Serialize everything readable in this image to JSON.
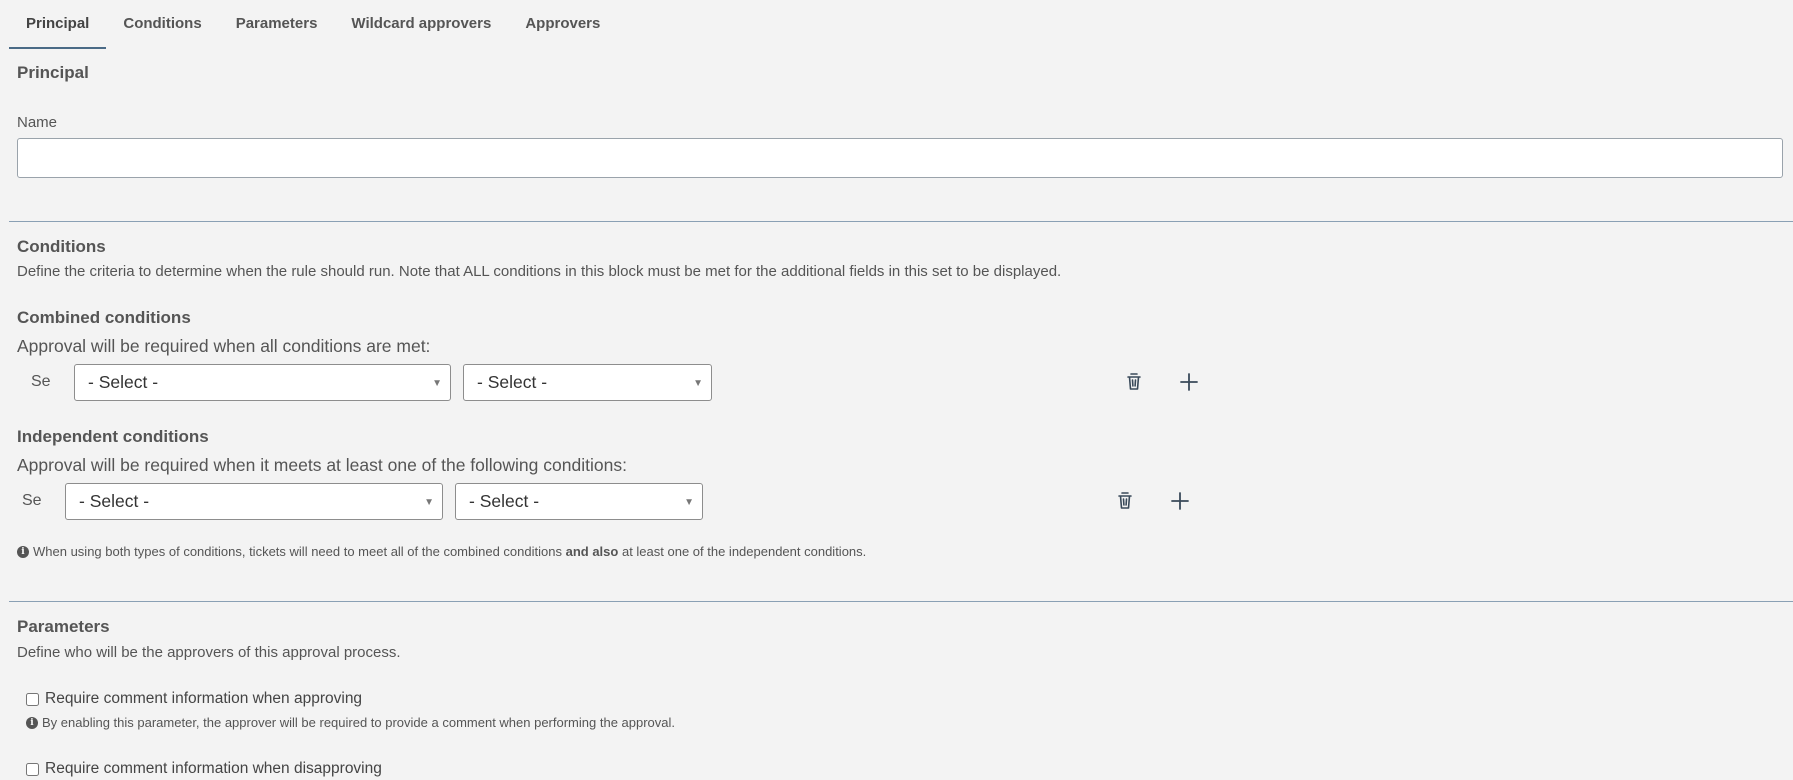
{
  "tabs": [
    "Principal",
    "Conditions",
    "Parameters",
    "Wildcard approvers",
    "Approvers"
  ],
  "principal": {
    "title": "Principal",
    "name_label": "Name",
    "name_value": ""
  },
  "conditions": {
    "title": "Conditions",
    "description": "Define the criteria to determine when the rule should run. Note that ALL conditions in this block must be met for the additional fields in this set to be displayed.",
    "combined": {
      "title": "Combined conditions",
      "description": "Approval will be required when all conditions are met:",
      "row_prefix": "Se",
      "select1": "- Select -",
      "select2": "- Select -"
    },
    "independent": {
      "title": "Independent conditions",
      "description": "Approval will be required when it meets at least one of the following conditions:",
      "row_prefix": "Se",
      "select1": "- Select -",
      "select2": "- Select -"
    },
    "note_part1": "When using both types of conditions, tickets will need to meet all of the combined conditions",
    "note_bold": "and also",
    "note_part2": "at least one of the independent conditions."
  },
  "parameters": {
    "title": "Parameters",
    "description": "Define who will be the approvers of this approval process.",
    "option1_label": "Require comment information when approving",
    "option1_checked": false,
    "option1_note": "By enabling this parameter, the approver will be required to provide a comment when performing the approval.",
    "option2_label": "Require comment information when disapproving",
    "option2_checked": false
  },
  "icons": {
    "info": "info-icon",
    "delete": "trash-icon",
    "add": "plus-icon"
  },
  "colors": {
    "background": "#f3f3f3",
    "divider": "#8aa0b4",
    "active_tab_underline": "#4a6a86",
    "icon": "#3a4a5a"
  }
}
